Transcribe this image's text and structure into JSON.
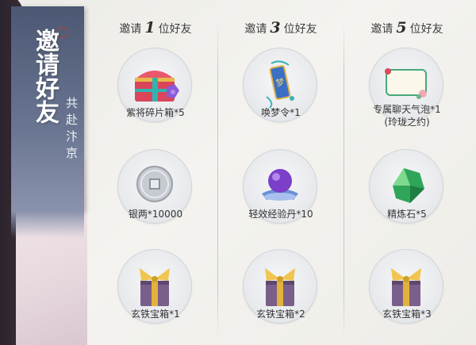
{
  "side_panel": {
    "title": "邀请好友",
    "subtitle": "共赴汴京"
  },
  "columns": [
    {
      "header": {
        "prefix": "邀请",
        "count": "1",
        "suffix": "位好友"
      },
      "items": [
        {
          "name": "紫将碎片箱*5",
          "icon": "treasure-chest-icon"
        },
        {
          "name": "银两*10000",
          "icon": "silver-coin-icon"
        },
        {
          "name": "玄铁宝箱*1",
          "icon": "gift-box-icon"
        }
      ]
    },
    {
      "header": {
        "prefix": "邀请",
        "count": "3",
        "suffix": "位好友"
      },
      "items": [
        {
          "name": "唤梦令*1",
          "icon": "dream-token-icon"
        },
        {
          "name": "轻效经验丹*10",
          "icon": "exp-orb-icon"
        },
        {
          "name": "玄铁宝箱*2",
          "icon": "gift-box-icon"
        }
      ]
    },
    {
      "header": {
        "prefix": "邀请",
        "count": "5",
        "suffix": "位好友"
      },
      "items": [
        {
          "name": "专属聊天气泡*1",
          "name2": "(玲珑之约)",
          "icon": "chat-bubble-icon"
        },
        {
          "name": "精炼石*5",
          "icon": "refining-stone-icon"
        },
        {
          "name": "玄铁宝箱*3",
          "icon": "gift-box-icon"
        }
      ]
    }
  ],
  "colors": {
    "panel": "#4c5873",
    "text": "#333333",
    "gift_ribbon": "#e2b23a"
  }
}
